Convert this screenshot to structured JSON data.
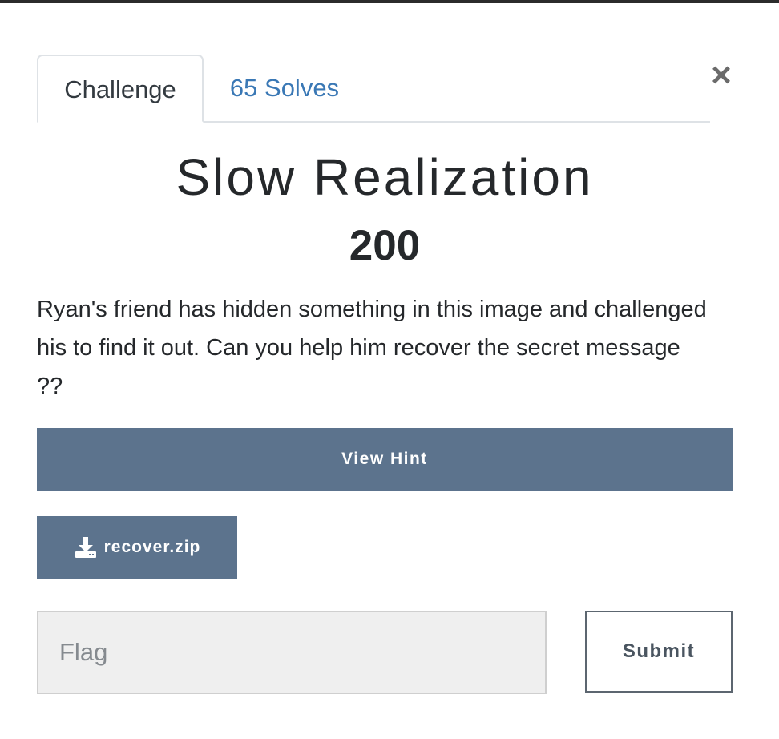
{
  "modal": {
    "tabs": [
      {
        "label": "Challenge",
        "active": true
      },
      {
        "label": "65 Solves",
        "active": false
      }
    ],
    "close_label": "×",
    "title": "Slow Realization",
    "points": "200",
    "description": "Ryan's friend has hidden something in this image and challenged his to find it out. Can you help him recover the secret message ??",
    "hint_label": "View Hint",
    "file_label": "recover.zip",
    "file_icon": "download-icon",
    "flag_placeholder": "Flag",
    "flag_value": "",
    "submit_label": "Submit"
  },
  "colors": {
    "button_bg": "#5c738d",
    "tab_link": "#3a78b5",
    "text": "#25282b"
  }
}
